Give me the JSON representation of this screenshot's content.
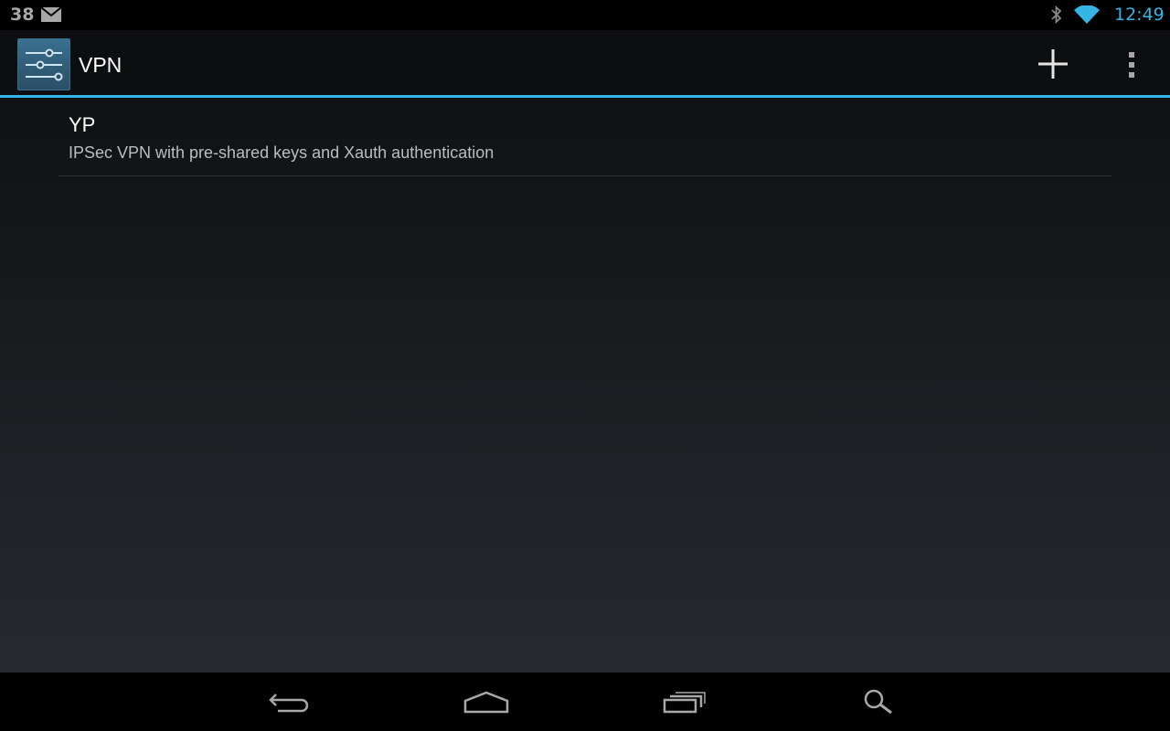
{
  "status_bar": {
    "notification_count": "38",
    "notification_icon": "mail-icon",
    "time": "12:49",
    "icons": [
      "bluetooth-icon",
      "wifi-icon"
    ]
  },
  "action_bar": {
    "title": "VPN",
    "app_icon": "settings-sliders-icon",
    "actions": [
      "add-icon",
      "overflow-menu-icon"
    ]
  },
  "vpn_list": [
    {
      "name": "YP",
      "description": "IPSec VPN with pre-shared keys and Xauth authentication"
    }
  ],
  "nav_bar": {
    "buttons": [
      "back-icon",
      "home-icon",
      "recents-icon",
      "search-icon"
    ]
  },
  "colors": {
    "accent": "#33b5e5",
    "background": "#000000",
    "text_primary": "#ffffff",
    "text_secondary": "#bdbdbd"
  }
}
